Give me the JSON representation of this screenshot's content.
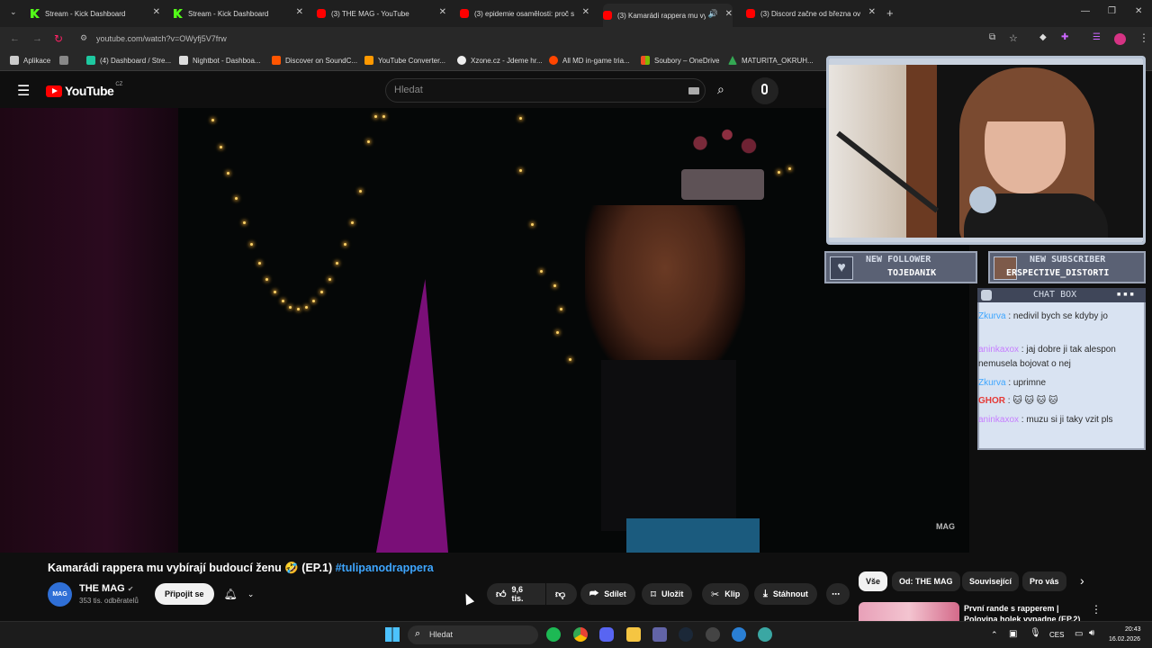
{
  "browser": {
    "tabs": [
      {
        "title": "Stream - Kick Dashboard",
        "icon": "kick-icon"
      },
      {
        "title": "Stream - Kick Dashboard",
        "icon": "kick-icon"
      },
      {
        "title": "(3) THE MAG - YouTube",
        "icon": "youtube-icon"
      },
      {
        "title": "(3) epidemie osamělosti: proč s",
        "icon": "youtube-icon"
      },
      {
        "title": "(3) Kamarádi rappera mu vy",
        "icon": "youtube-icon"
      },
      {
        "title": "(3) Discord začne od března ov",
        "icon": "youtube-icon"
      }
    ],
    "url": "youtube.com/watch?v=OWyfj5V7frw",
    "bookmarks": [
      "Aplikace",
      "(4) Dashboard / Stre...",
      "Nightbot - Dashboa...",
      "Discover on SoundC...",
      "YouTube Converter...",
      "Xzone.cz - Jdeme hr...",
      "All MD in-game tria...",
      "Soubory – OneDrive",
      "MATURITA_OKRUH..."
    ]
  },
  "youtube": {
    "logo": "YouTube",
    "region": "CZ",
    "search_placeholder": "Hledat",
    "video_title": "Kamarádi rappera mu vybírají budoucí ženu 🤣 (EP.1)",
    "hashtag": "#tulipanodrappera",
    "channel": {
      "name": "THE MAG",
      "subscribers": "353 tis. odběratelů",
      "avatar_text": "MAG"
    },
    "join_label": "Připojit se",
    "actions": {
      "likes": "9,6 tis.",
      "share": "Sdílet",
      "save": "Uložit",
      "clip": "Klip",
      "download": "Stáhnout"
    },
    "chips": [
      "Vše",
      "Od: THE MAG",
      "Související",
      "Pro vás"
    ],
    "next_video": {
      "title_line1": "První rande s rapperem |",
      "title_line2": "Polovina holek vypadne (EP.2)"
    },
    "watermark": "MAG"
  },
  "stream_overlay": {
    "new_follower_label": "NEW FOLLOWER",
    "new_follower_name": "TOJEDANIK",
    "new_subscriber_label": "NEW SUBSCRIBER",
    "new_subscriber_name": "ERSPECTIVE_DISTORTI",
    "chatbox_title": "CHAT BOX",
    "chat": [
      {
        "user": "Zkurva",
        "text": " : nedivil bych se kdyby jo",
        "user_color": "#3ea6ff"
      },
      {
        "user": "aninkaxox",
        "text": " : jaj dobre ji tak alespon nemusela bojovat o nej",
        "user_color": "#c77dff"
      },
      {
        "user": "Zkurva",
        "text": " : uprimne",
        "user_color": "#3ea6ff"
      },
      {
        "user": "GHOR",
        "text": " : 🐱 🐱 🐱 🐱",
        "user_color": "#e53935"
      },
      {
        "user": "aninkaxox",
        "text": " : muzu si ji taky vzit pls",
        "user_color": "#c77dff"
      }
    ]
  },
  "taskbar": {
    "search_placeholder": "Hledat",
    "language": "CES",
    "time": "20:43",
    "date": "16.02.2026"
  }
}
